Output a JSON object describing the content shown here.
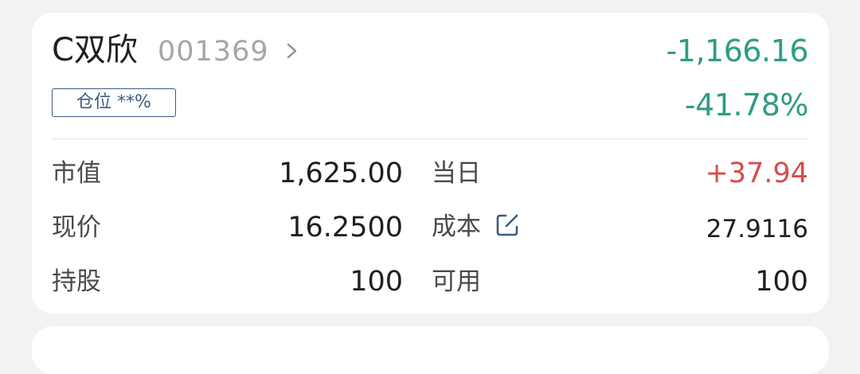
{
  "stock": {
    "name": "C双欣",
    "code": "001369",
    "position_label": "仓位 **%",
    "profit_loss_amount": "-1,166.16",
    "profit_loss_percent": "-41.78%"
  },
  "metrics": {
    "market_value_label": "市值",
    "market_value": "1,625.00",
    "today_label": "当日",
    "today_value": "+37.94",
    "current_price_label": "现价",
    "current_price": "16.2500",
    "cost_label": "成本",
    "cost_value": "27.9116",
    "holdings_label": "持股",
    "holdings_value": "100",
    "available_label": "可用",
    "available_value": "100"
  },
  "colors": {
    "loss_green": "#2e9d84",
    "gain_red": "#d94b4b",
    "badge_blue": "#3d5a82",
    "code_gray": "#a3a6ab"
  },
  "icons": {
    "chevron": "chevron-right-icon",
    "edit": "edit-icon"
  }
}
